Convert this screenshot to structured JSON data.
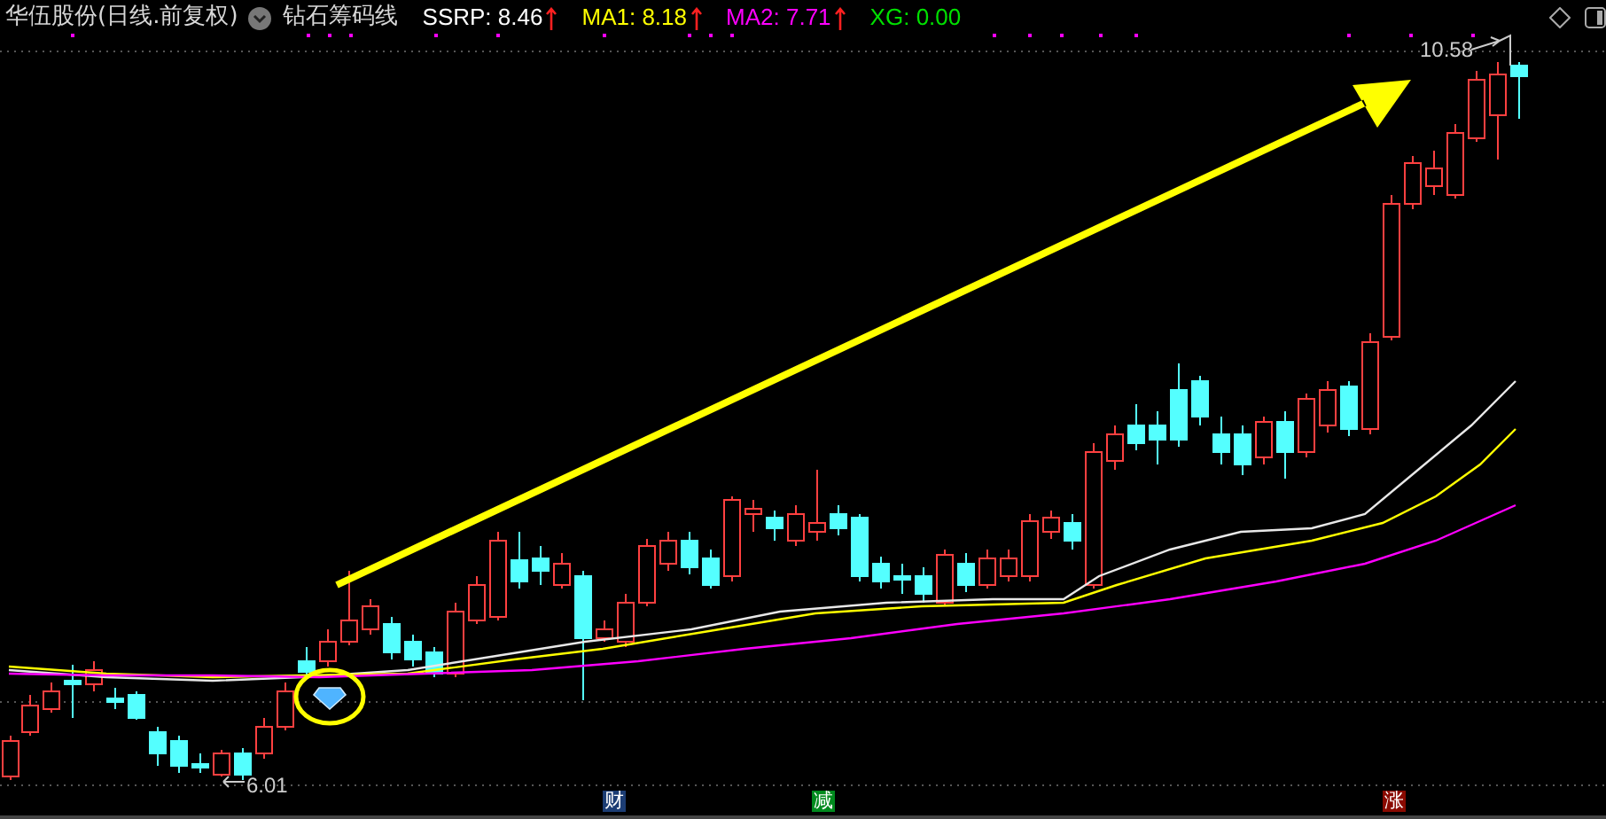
{
  "header": {
    "stock_title": "华伍股份(日线.前复权)",
    "indicator_name": "钻石筹码线",
    "values": [
      {
        "label": "SSRP:",
        "value": "8.46",
        "color": "#ffffff",
        "rising": true
      },
      {
        "label": "MA1:",
        "value": "8.18",
        "color": "#ffff00",
        "rising": true
      },
      {
        "label": "MA2:",
        "value": "7.71",
        "color": "#ff00ff",
        "rising": true
      },
      {
        "label": "XG:",
        "value": "0.00",
        "color": "#00e000",
        "rising": false
      }
    ]
  },
  "chart": {
    "high_label": "10.58",
    "low_label": "6.01",
    "markers": [
      {
        "label": "财",
        "color": "#1c3d74"
      },
      {
        "label": "减",
        "color": "#008a1e"
      },
      {
        "label": "涨",
        "color": "#8a0a00"
      }
    ]
  }
}
